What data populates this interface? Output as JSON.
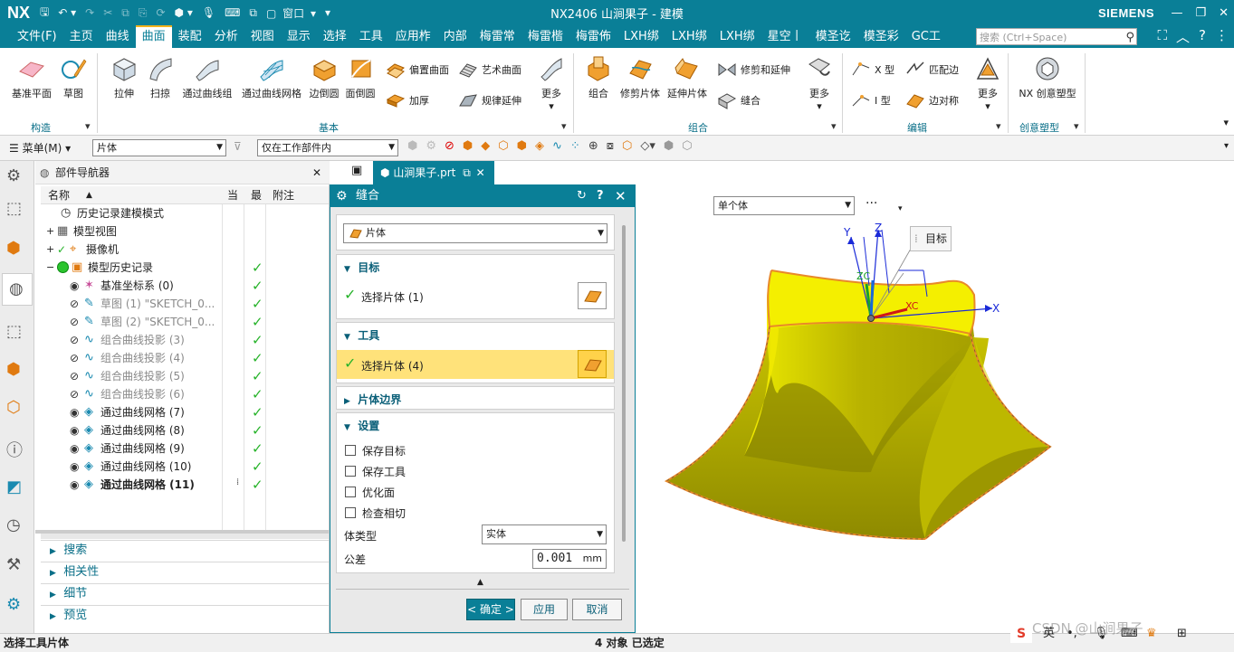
{
  "titlebar": {
    "logo": "NX",
    "window_menu": "窗口",
    "title": "NX2406 山涧果子 - 建模",
    "brand": "SIEMENS"
  },
  "menubar": {
    "items": [
      "文件(F)",
      "主页",
      "曲线",
      "曲面",
      "装配",
      "分析",
      "视图",
      "显示",
      "选择",
      "工具",
      "应用柞",
      "内部",
      "梅雷常",
      "梅雷楷",
      "梅雷佈",
      "LXH绑",
      "LXH绑",
      "LXH绑",
      "星空丨",
      "模圣讫",
      "模圣彩",
      "GC工"
    ],
    "active_index": 3,
    "search_placeholder": "搜索 (Ctrl+Space)"
  },
  "ribbon": {
    "construct": {
      "items": [
        "基准平面",
        "草图"
      ],
      "group": "构造"
    },
    "basic": {
      "items": [
        "拉伸",
        "扫掠",
        "通过曲线组",
        "通过曲线网格",
        "边倒圆",
        "面倒圆"
      ],
      "small": [
        "偏置曲面",
        "艺术曲面",
        "加厚",
        "规律延伸"
      ],
      "more": "更多",
      "group": "基本"
    },
    "combine": {
      "items": [
        "组合",
        "修剪片体",
        "延伸片体"
      ],
      "small": [
        "修剪和延伸",
        "缝合"
      ],
      "more": "更多",
      "group": "组合"
    },
    "edit": {
      "small": [
        "X 型",
        "匹配边",
        "I 型",
        "边对称"
      ],
      "more": "更多",
      "group": "编辑"
    },
    "freeform": {
      "items": [
        "NX 创意塑型"
      ],
      "group": "创意塑型"
    }
  },
  "seltb": {
    "menu_label": "菜单(M)",
    "filter": "片体",
    "scope": "仅在工作部件内"
  },
  "navigator": {
    "title": "部件导航器",
    "columns": [
      "名称",
      "当",
      "最",
      "附注"
    ],
    "rows": [
      {
        "label": "历史记录建模模式",
        "style": "normal",
        "check": false,
        "icon": "clock-icon",
        "indent": 1
      },
      {
        "label": "模型视图",
        "style": "normal",
        "check": false,
        "icon": "folder-icon",
        "indent": 0,
        "expand": "+"
      },
      {
        "label": "摄像机",
        "style": "normal",
        "check": false,
        "icon": "camera-icon",
        "indent": 0,
        "expand": "+"
      },
      {
        "label": "模型历史记录",
        "style": "normal",
        "check": true,
        "icon": "history-icon",
        "indent": 0,
        "expand": "−"
      },
      {
        "label": "基准坐标系 (0)",
        "style": "normal",
        "check": true,
        "icon": "datum-csys-icon",
        "indent": 2
      },
      {
        "label": "草图 (1) \"SKETCH_0...",
        "style": "gray",
        "check": true,
        "icon": "sketch-icon",
        "indent": 2
      },
      {
        "label": "草图 (2) \"SKETCH_0...",
        "style": "gray",
        "check": true,
        "icon": "sketch-icon",
        "indent": 2
      },
      {
        "label": "组合曲线投影 (3)",
        "style": "gray",
        "check": true,
        "icon": "curve-project-icon",
        "indent": 2
      },
      {
        "label": "组合曲线投影 (4)",
        "style": "gray",
        "check": true,
        "icon": "curve-project-icon",
        "indent": 2
      },
      {
        "label": "组合曲线投影 (5)",
        "style": "gray",
        "check": true,
        "icon": "curve-project-icon",
        "indent": 2
      },
      {
        "label": "组合曲线投影 (6)",
        "style": "gray",
        "check": true,
        "icon": "curve-project-icon",
        "indent": 2
      },
      {
        "label": "通过曲线网格 (7)",
        "style": "normal",
        "check": true,
        "icon": "mesh-surface-icon",
        "indent": 2
      },
      {
        "label": "通过曲线网格 (8)",
        "style": "normal",
        "check": true,
        "icon": "mesh-surface-icon",
        "indent": 2
      },
      {
        "label": "通过曲线网格 (9)",
        "style": "normal",
        "check": true,
        "icon": "mesh-surface-icon",
        "indent": 2
      },
      {
        "label": "通过曲线网格 (10)",
        "style": "normal",
        "check": true,
        "icon": "mesh-surface-icon",
        "indent": 2
      },
      {
        "label": "通过曲线网格 (11)",
        "style": "bold",
        "check": true,
        "icon": "mesh-surface-icon",
        "indent": 2
      }
    ],
    "sections": [
      "搜索",
      "相关性",
      "细节",
      "预览"
    ]
  },
  "tab": {
    "label": "山涧果子.prt"
  },
  "dialog": {
    "title": "缝合",
    "type_value": "片体",
    "target": {
      "title": "目标",
      "select_label": "选择片体 (1)"
    },
    "tool": {
      "title": "工具",
      "select_label": "选择片体 (4)"
    },
    "edges": {
      "title": "片体边界"
    },
    "settings": {
      "title": "设置",
      "options": [
        "保存目标",
        "保存工具",
        "优化面",
        "检查相切"
      ],
      "body_type_label": "体类型",
      "body_type_value": "实体",
      "tolerance_label": "公差",
      "tolerance_value": "0.001",
      "tolerance_unit": "mm"
    },
    "buttons": {
      "ok": "< 确定 >",
      "apply": "应用",
      "cancel": "取消"
    }
  },
  "viewport": {
    "filter": "单个体",
    "more": "···",
    "tooltip": "目标",
    "axes": {
      "y": "Y",
      "z": "Z",
      "x": "X",
      "xc": "XC",
      "zc": "ZC"
    }
  },
  "status": {
    "left": "选择工具片体",
    "center": "4 对象 已选定",
    "ime": "英",
    "watermark": "CSDN @山涧果子"
  },
  "colors": {
    "teal": "#0a7f97",
    "surface": "#e2e000",
    "surface_dark": "#8a8a00",
    "edge": "#e8892a",
    "highlight": "#ffe27a"
  }
}
